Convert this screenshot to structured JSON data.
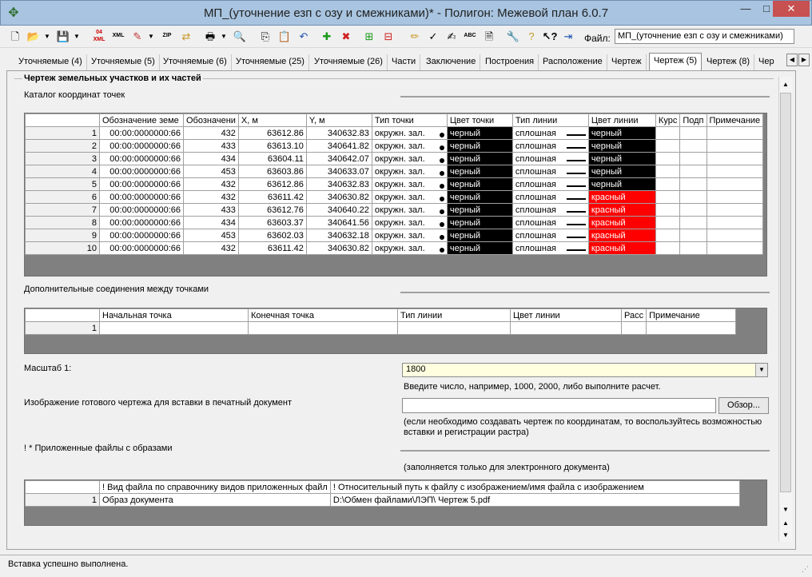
{
  "window": {
    "title": "МП_(уточнение езп с озу и смежниками)* - Полигон: Межевой план 6.0.7",
    "minimize": "—",
    "maximize": "□",
    "close": "✕"
  },
  "toolbar": {
    "icons": [
      "new-document",
      "open-folder",
      "dropdown",
      "save",
      "dropdown",
      "xml-04",
      "xml",
      "edit-xml",
      "dropdown",
      "zip",
      "transfer",
      "print",
      "dropdown",
      "print-preview",
      "copy",
      "paste",
      "undo",
      "add-green",
      "delete-red",
      "add-node",
      "remove-node",
      "pen",
      "xml-check",
      "xml-sign",
      "spellcheck",
      "document-edit",
      "tools",
      "help",
      "context-help",
      "exit"
    ],
    "file_label": "Файл:",
    "file_value": "МП_(уточнение езп с озу и смежниками)"
  },
  "tabs": [
    "Уточняемые (4)",
    "Уточняемые (5)",
    "Уточняемые (6)",
    "Уточняемые (25)",
    "Уточняемые (26)",
    "Части",
    "Заключение",
    "Построения",
    "Расположение",
    "Чертеж",
    "Чертеж (5)",
    "Чертеж (8)",
    "Чер"
  ],
  "active_tab": "Чертеж (5)",
  "section": {
    "title": "Чертеж земельных участков и их частей",
    "catalog_label": "Каталог координат точек",
    "extra_label": "Дополнительные соединения между точками",
    "scale_label": "Масштаб 1:",
    "scale_value": "1800",
    "scale_hint": "Введите число, например, 1000, 2000, либо выполните расчет.",
    "image_label": "Изображение готового чертежа для вставки в печатный документ",
    "browse_button": "Обзор...",
    "image_hint_1": "(если необходимо создавать чертеж по координатам, то воспользуйтесь возможностью",
    "image_hint_2": "вставки и регистрации растра)",
    "files_label": "! * Приложенные файлы с образами",
    "files_hint": "(заполняется только для электронного документа)"
  },
  "points_table": {
    "headers": [
      "Обозначение земе",
      "Обозначени",
      "X, м",
      "Y, м",
      "Тип точки",
      "Цвет точки",
      "Тип линии",
      "Цвет линии",
      "Курс",
      "Подп",
      "Примечание"
    ],
    "rows": [
      {
        "n": "1",
        "zu": "00:00:0000000:66",
        "pt": "432",
        "x": "63612.86",
        "y": "340632.83",
        "type": "окружн. зал.",
        "pcolor": "черный",
        "ltype": "сплошная",
        "lcolor": "черный",
        "lred": false
      },
      {
        "n": "2",
        "zu": "00:00:0000000:66",
        "pt": "433",
        "x": "63613.10",
        "y": "340641.82",
        "type": "окружн. зал.",
        "pcolor": "черный",
        "ltype": "сплошная",
        "lcolor": "черный",
        "lred": false
      },
      {
        "n": "3",
        "zu": "00:00:0000000:66",
        "pt": "434",
        "x": "63604.11",
        "y": "340642.07",
        "type": "окружн. зал.",
        "pcolor": "черный",
        "ltype": "сплошная",
        "lcolor": "черный",
        "lred": false
      },
      {
        "n": "4",
        "zu": "00:00:0000000:66",
        "pt": "453",
        "x": "63603.86",
        "y": "340633.07",
        "type": "окружн. зал.",
        "pcolor": "черный",
        "ltype": "сплошная",
        "lcolor": "черный",
        "lred": false
      },
      {
        "n": "5",
        "zu": "00:00:0000000:66",
        "pt": "432",
        "x": "63612.86",
        "y": "340632.83",
        "type": "окружн. зал.",
        "pcolor": "черный",
        "ltype": "сплошная",
        "lcolor": "черный",
        "lred": false
      },
      {
        "n": "6",
        "zu": "00:00:0000000:66",
        "pt": "432",
        "x": "63611.42",
        "y": "340630.82",
        "type": "окружн. зал.",
        "pcolor": "черный",
        "ltype": "сплошная",
        "lcolor": "красный",
        "lred": true
      },
      {
        "n": "7",
        "zu": "00:00:0000000:66",
        "pt": "433",
        "x": "63612.76",
        "y": "340640.22",
        "type": "окружн. зал.",
        "pcolor": "черный",
        "ltype": "сплошная",
        "lcolor": "красный",
        "lred": true
      },
      {
        "n": "8",
        "zu": "00:00:0000000:66",
        "pt": "434",
        "x": "63603.37",
        "y": "340641.56",
        "type": "окружн. зал.",
        "pcolor": "черный",
        "ltype": "сплошная",
        "lcolor": "красный",
        "lred": true
      },
      {
        "n": "9",
        "zu": "00:00:0000000:66",
        "pt": "453",
        "x": "63602.03",
        "y": "340632.18",
        "type": "окружн. зал.",
        "pcolor": "черный",
        "ltype": "сплошная",
        "lcolor": "красный",
        "lred": true
      },
      {
        "n": "10",
        "zu": "00:00:0000000:66",
        "pt": "432",
        "x": "63611.42",
        "y": "340630.82",
        "type": "окружн. зал.",
        "pcolor": "черный",
        "ltype": "сплошная",
        "lcolor": "красный",
        "lred": true
      }
    ]
  },
  "connections_table": {
    "headers": [
      "Начальная точка",
      "Конечная точка",
      "Тип линии",
      "Цвет линии",
      "Расс",
      "Примечание"
    ],
    "rows": [
      {
        "n": "1",
        "start": "",
        "end": "",
        "ltype": "",
        "lcolor": "",
        "dist": "",
        "note": ""
      }
    ]
  },
  "files_table": {
    "headers": [
      "! Вид файла по справочнику видов приложенных файл",
      "! Относительный путь к файлу с изображением/имя файла с изображением"
    ],
    "rows": [
      {
        "n": "1",
        "kind": "Образ документа",
        "path": "D:\\Обмен файлами\\ЛЭП\\ Чертеж 5.pdf"
      }
    ]
  },
  "status": {
    "text": "Вставка успешно выполнена."
  },
  "colors": {
    "titlebar": "#a8c4e0",
    "close_button": "#c75050",
    "grid_background": "#808080",
    "scale_input_background": "#ffffe0",
    "black_cell": "#000000",
    "red_cell": "#ff0000"
  }
}
